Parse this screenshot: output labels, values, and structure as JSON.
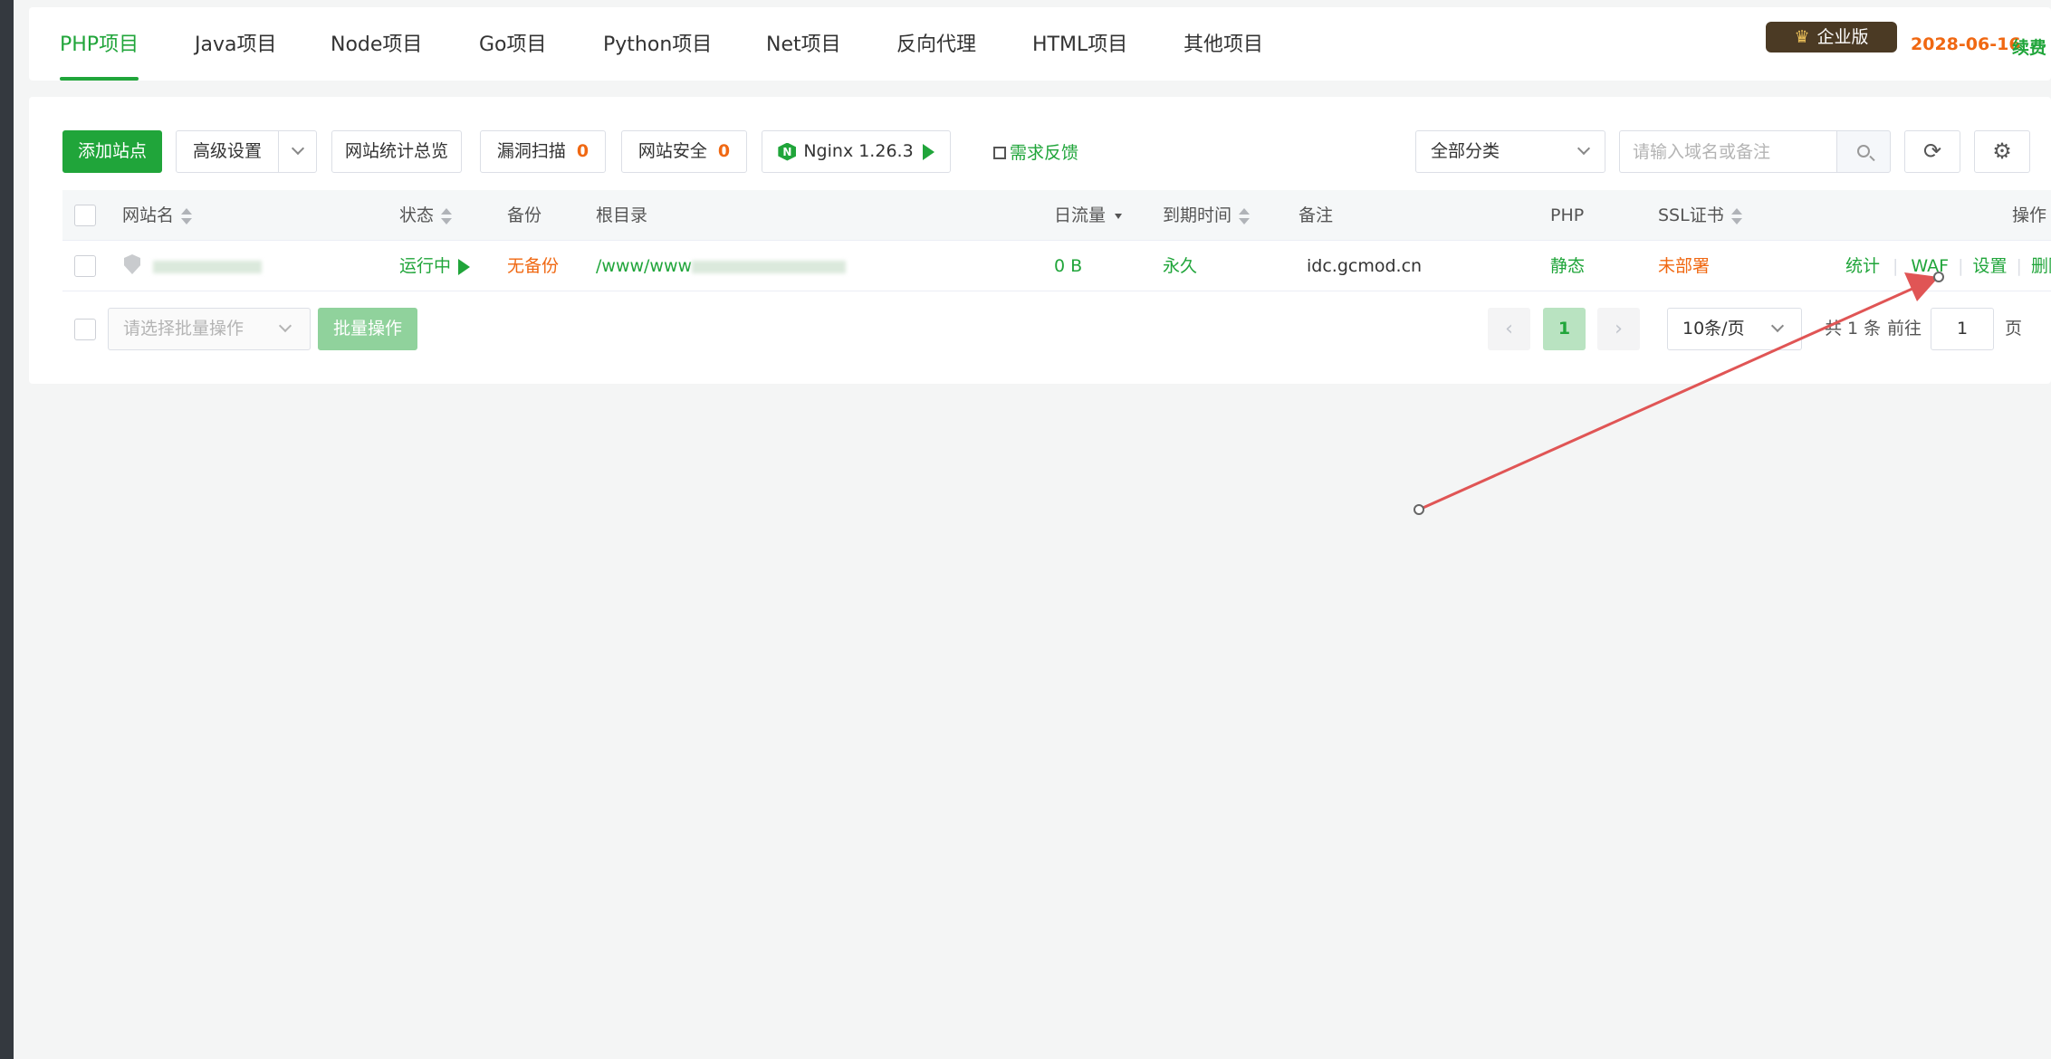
{
  "tabs": [
    "PHP项目",
    "Java项目",
    "Node项目",
    "Go项目",
    "Python项目",
    "Net项目",
    "反向代理",
    "HTML项目",
    "其他项目"
  ],
  "edition": {
    "icon": "crown-icon",
    "label": "企业版"
  },
  "expiry_date": "2028-06-16",
  "renew_label": "续费",
  "toolbar": {
    "add_site": "添加站点",
    "advanced": "高级设置",
    "stats_overview": "网站统计总览",
    "vuln_scan": "漏洞扫描",
    "vuln_count": "0",
    "site_security": "网站安全",
    "security_count": "0",
    "nginx": "Nginx 1.26.3",
    "feedback": "需求反馈"
  },
  "filter": {
    "category": "全部分类",
    "search_placeholder": "请输入域名或备注",
    "refresh_icon": "refresh-icon",
    "settings_icon": "gear-icon"
  },
  "table": {
    "headers": {
      "name": "网站名",
      "status": "状态",
      "backup": "备份",
      "root": "根目录",
      "traffic": "日流量",
      "expire": "到期时间",
      "remark": "备注",
      "php": "PHP",
      "ssl": "SSL证书",
      "ops": "操作"
    },
    "rows": [
      {
        "status": "运行中",
        "backup": "无备份",
        "root": "/www/www",
        "traffic": "0 B",
        "expire": "永久",
        "remark": "idc.gcmod.cn",
        "php": "静态",
        "ssl": "未部署",
        "ops": [
          "统计",
          "WAF",
          "设置",
          "删除"
        ]
      }
    ]
  },
  "footer": {
    "batch_placeholder": "请选择批量操作",
    "batch_button": "批量操作",
    "current_page": "1",
    "page_size": "10条/页",
    "total": "共 1 条",
    "goto_label": "前往",
    "goto_value": "1",
    "page_suffix": "页"
  },
  "colors": {
    "accent": "#20a53a",
    "warning": "#f06812",
    "annotation_arrow": "#e05555"
  }
}
